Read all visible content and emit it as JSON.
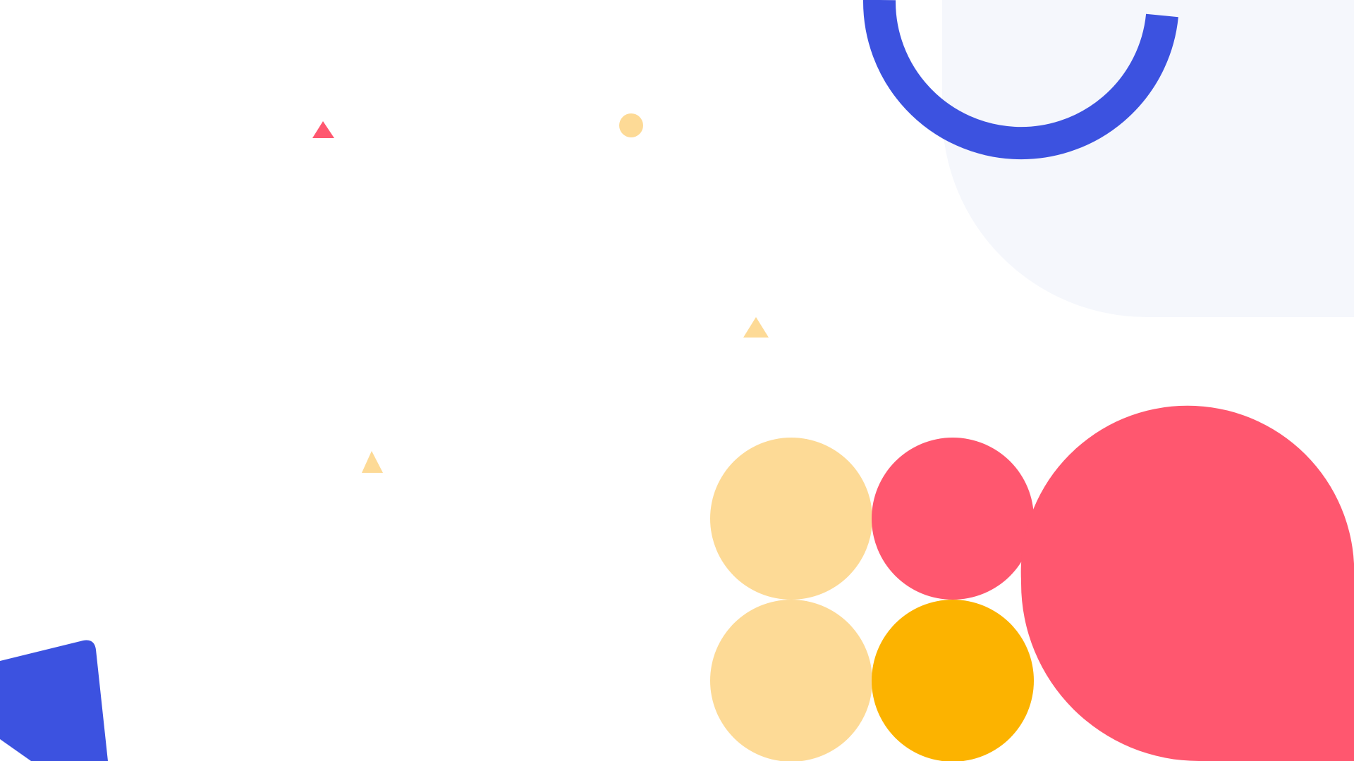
{
  "palette": {
    "background": "#ffffff",
    "panel": "#f5f7fc",
    "blue": "#3c52e0",
    "red": "#ff576f",
    "light_yellow": "#fdda96",
    "amber": "#fcb300"
  },
  "shapes": [
    {
      "name": "top-right-panel",
      "kind": "rounded-panel",
      "color": "panel"
    },
    {
      "name": "blue-arc-ring",
      "kind": "arc",
      "color": "blue"
    },
    {
      "name": "red-triangle-small",
      "kind": "triangle",
      "color": "red"
    },
    {
      "name": "yellow-dot-small",
      "kind": "circle",
      "color": "light_yellow"
    },
    {
      "name": "yellow-triangle-center",
      "kind": "triangle",
      "color": "light_yellow"
    },
    {
      "name": "yellow-triangle-left",
      "kind": "triangle",
      "color": "light_yellow"
    },
    {
      "name": "light-yellow-circle-top",
      "kind": "circle",
      "color": "light_yellow"
    },
    {
      "name": "red-circle-top",
      "kind": "circle",
      "color": "red"
    },
    {
      "name": "red-large-blob",
      "kind": "blob",
      "color": "red"
    },
    {
      "name": "light-yellow-circle-bottom",
      "kind": "circle",
      "color": "light_yellow"
    },
    {
      "name": "amber-circle-bottom",
      "kind": "circle",
      "color": "amber"
    },
    {
      "name": "blue-polygon-bottom-left",
      "kind": "polygon",
      "color": "blue"
    }
  ]
}
